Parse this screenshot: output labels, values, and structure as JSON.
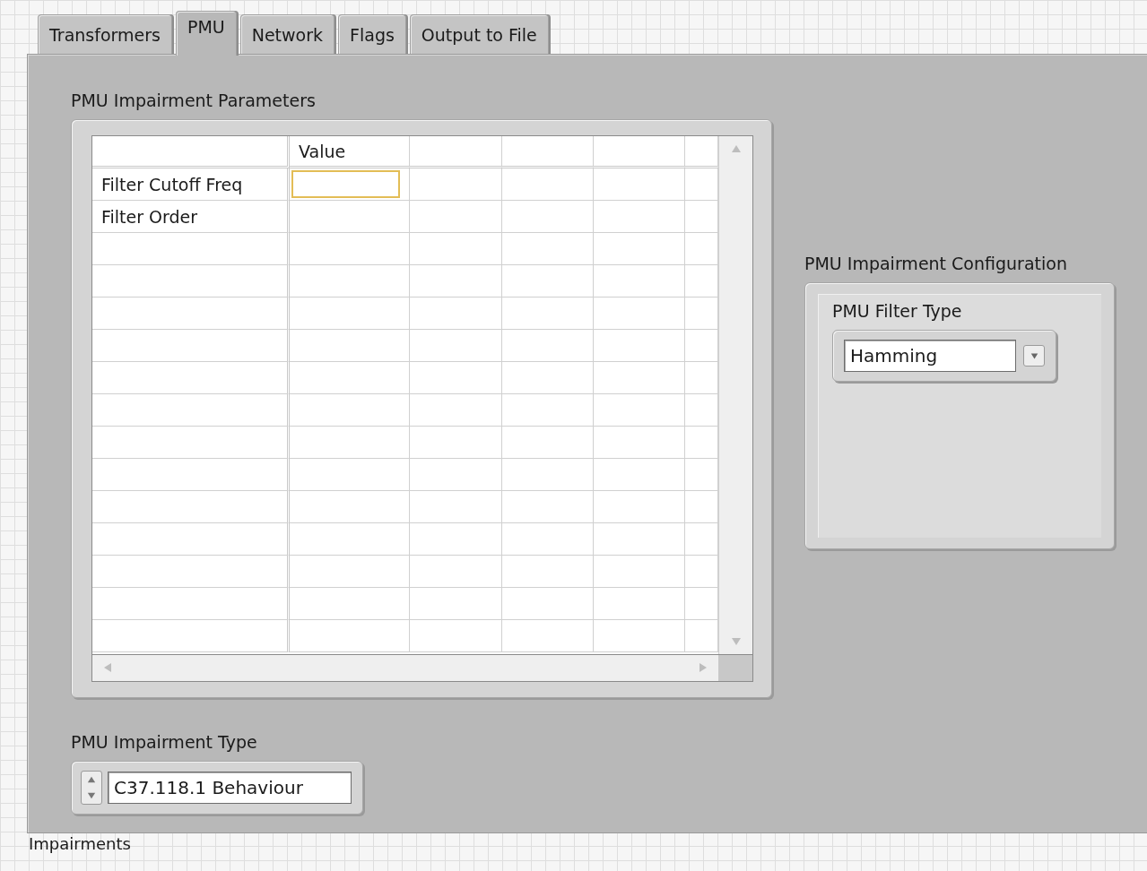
{
  "tabs": [
    {
      "label": "Transformers",
      "selected": false
    },
    {
      "label": "PMU",
      "selected": true
    },
    {
      "label": "Network",
      "selected": false
    },
    {
      "label": "Flags",
      "selected": false
    },
    {
      "label": "Output to File",
      "selected": false
    }
  ],
  "parameters": {
    "label": "PMU Impairment Parameters",
    "columns": [
      "Value"
    ],
    "rows": [
      {
        "label": "Filter Cutoff Freq",
        "focused": true
      },
      {
        "label": "Filter Order",
        "focused": false
      }
    ]
  },
  "configuration": {
    "label": "PMU Impairment Configuration",
    "filter_type": {
      "label": "PMU Filter Type",
      "value": "Hamming"
    }
  },
  "impairment_type": {
    "label": "PMU Impairment Type",
    "value": "C37.118.1 Behaviour"
  },
  "footer_label": "Impairments"
}
